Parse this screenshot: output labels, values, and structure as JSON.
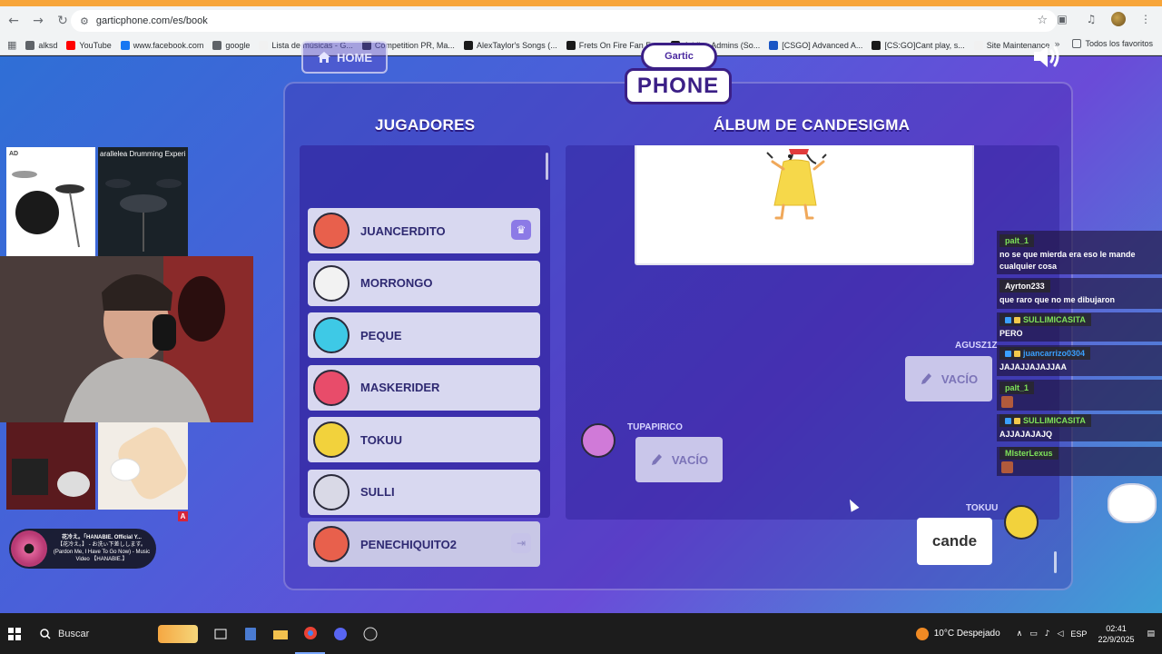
{
  "browser": {
    "url": "garticphone.com/es/book",
    "bookmarks": [
      {
        "label": "alksd",
        "color": "#5f6368"
      },
      {
        "label": "YouTube",
        "color": "#ff0000"
      },
      {
        "label": "www.facebook.com",
        "color": "#1877f2"
      },
      {
        "label": "google",
        "color": "#5f6368"
      },
      {
        "label": "Lista de músicas - G...",
        "color": "#f1f1f1"
      },
      {
        "label": "Competition PR, Ma...",
        "color": "#1a1a1a"
      },
      {
        "label": "AlexTaylor's Songs (...",
        "color": "#1a1a1a"
      },
      {
        "label": "Frets On Fire Fan Fo...",
        "color": "#1a1a1a"
      },
      {
        "label": "Adding Admins (So...",
        "color": "#1a1a1a"
      },
      {
        "label": "[CSGO] Advanced A...",
        "color": "#1a56c4"
      },
      {
        "label": "[CS:GO]Cant play, s...",
        "color": "#1a1a1a"
      },
      {
        "label": "Site Maintenance",
        "color": "#f1f1f1"
      }
    ],
    "all_bookmarks_label": "Todos los favoritos"
  },
  "game": {
    "home_label": "HOME",
    "logo_top": "Gartic",
    "logo_main": "PHONE",
    "players_title": "JUGADORES",
    "album_title": "ÁLBUM DE CANDESIGMA",
    "players": [
      {
        "name": "JUANCERDITO",
        "avatar_color": "#e8604c",
        "badge": "crown-icon"
      },
      {
        "name": "MORRONGO",
        "avatar_color": "#f2f2f2",
        "badge": ""
      },
      {
        "name": "PEQUE",
        "avatar_color": "#3ec9e6",
        "badge": ""
      },
      {
        "name": "MASKERIDER",
        "avatar_color": "#e84c6a",
        "badge": ""
      },
      {
        "name": "TOKUU",
        "avatar_color": "#f2d23c",
        "badge": ""
      },
      {
        "name": "SULLI",
        "avatar_color": "#d9d9e6",
        "badge": ""
      },
      {
        "name": "PENECHIQUITO2",
        "avatar_color": "#e8604c",
        "badge": "leave-icon"
      }
    ],
    "album": {
      "entries": [
        {
          "author": "AGUSZ1Z",
          "content": "VACÍO"
        },
        {
          "author": "TUPAPIRICO",
          "content": "VACÍO"
        },
        {
          "author": "TOKUU",
          "content": "cande"
        }
      ]
    }
  },
  "chat": [
    {
      "user": "palt_1",
      "user_color": "#7ee35a",
      "message": "no se que mierda era eso le mande cualquier cosa"
    },
    {
      "user": "Ayrton233",
      "user_color": "#ffffff",
      "message": "que raro que no me dibujaron"
    },
    {
      "user": "SULLIMICASITA",
      "user_color": "#7ee35a",
      "message": "PERO"
    },
    {
      "user": "juancarrizo0304",
      "user_color": "#3aa0ff",
      "message": "JAJAJJAJAJJAA"
    },
    {
      "user": "palt_1",
      "user_color": "#7ee35a",
      "message": ""
    },
    {
      "user": "SULLIMICASITA",
      "user_color": "#7ee35a",
      "message": "AJJAJAJAJQ"
    },
    {
      "user": "MIsterLexus",
      "user_color": "#7ee35a",
      "message": ""
    }
  ],
  "overlays": {
    "ad_label": "AD",
    "ad_caption": "arallelea Drumming Experi",
    "ad_badge": "A",
    "music_title": "花冷え。「HANABIE. Official Y...",
    "music_line2": "【花冷え。】 - お洗ぃ下差しします。",
    "music_line3": "(Pardon Me, I Have To Go Now) - Music Video 【HANABIE.】"
  },
  "taskbar": {
    "search_placeholder": "Buscar",
    "weather": "10°C  Despejado",
    "language": "ESP",
    "time": "02:41",
    "date": "22/9/2025"
  }
}
